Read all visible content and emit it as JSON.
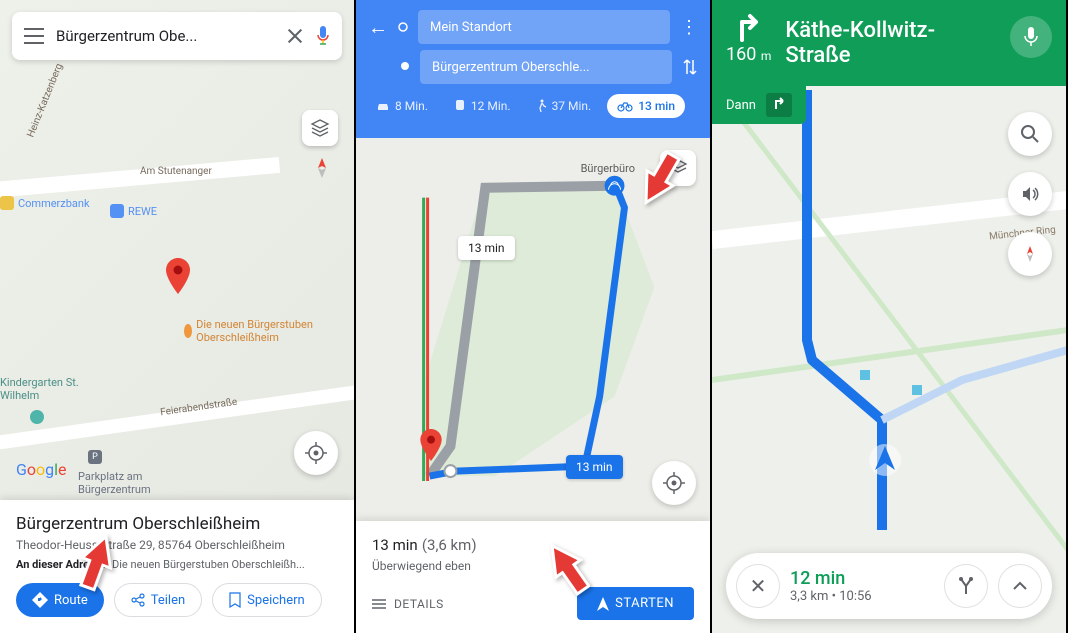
{
  "panel1": {
    "search_text": "Bürgerzentrum Obe...",
    "pois": {
      "commerzbank": "Commerzbank",
      "rewe": "REWE",
      "kindergarten": "Kindergarten St. Wilhelm",
      "parkplatz": "Parkplatz am Bürgerzentrum",
      "restaurant": "Die neuen Bürgerstuben Oberschleißheim"
    },
    "roads": {
      "katzenberg": "Heinz-Katzenberg",
      "stutenanger": "Am Stutenanger",
      "feierabend": "Feierabendstraße"
    },
    "google": "Google",
    "card_title": "Bürgerzentrum Oberschleißheim",
    "card_address": "Theodor-Heuss-Straße 29, 85764 Oberschleißheim",
    "card_note_prefix": "An dieser Adresse:",
    "card_note_text": " Die neuen Bürgerstuben Oberschleißh...",
    "btn_route": "Route",
    "btn_share": "Teilen",
    "btn_save": "Speichern"
  },
  "panel2": {
    "from": "Mein Standort",
    "to": "Bürgerzentrum Oberschle...",
    "mode_car": "8 Min.",
    "mode_transit": "12 Min.",
    "mode_walk": "37 Min.",
    "mode_bike": "13 min",
    "bubble_time": "13 min",
    "bubble_time2": "13 min",
    "burger_label": "Bürgerbüro",
    "summary_time": "13 min",
    "summary_dist": "(3,6 km)",
    "terrain": "Überwiegend eben",
    "details": "DETAILS",
    "start": "STARTEN"
  },
  "panel3": {
    "distance": "160",
    "distance_unit": "m",
    "street": "Käthe-Kollwitz-Straße",
    "then": "Dann",
    "road_label": "Münchner Ring",
    "eta": "12 min",
    "sub_dist": "3,3 km",
    "sub_time": "10:56"
  }
}
